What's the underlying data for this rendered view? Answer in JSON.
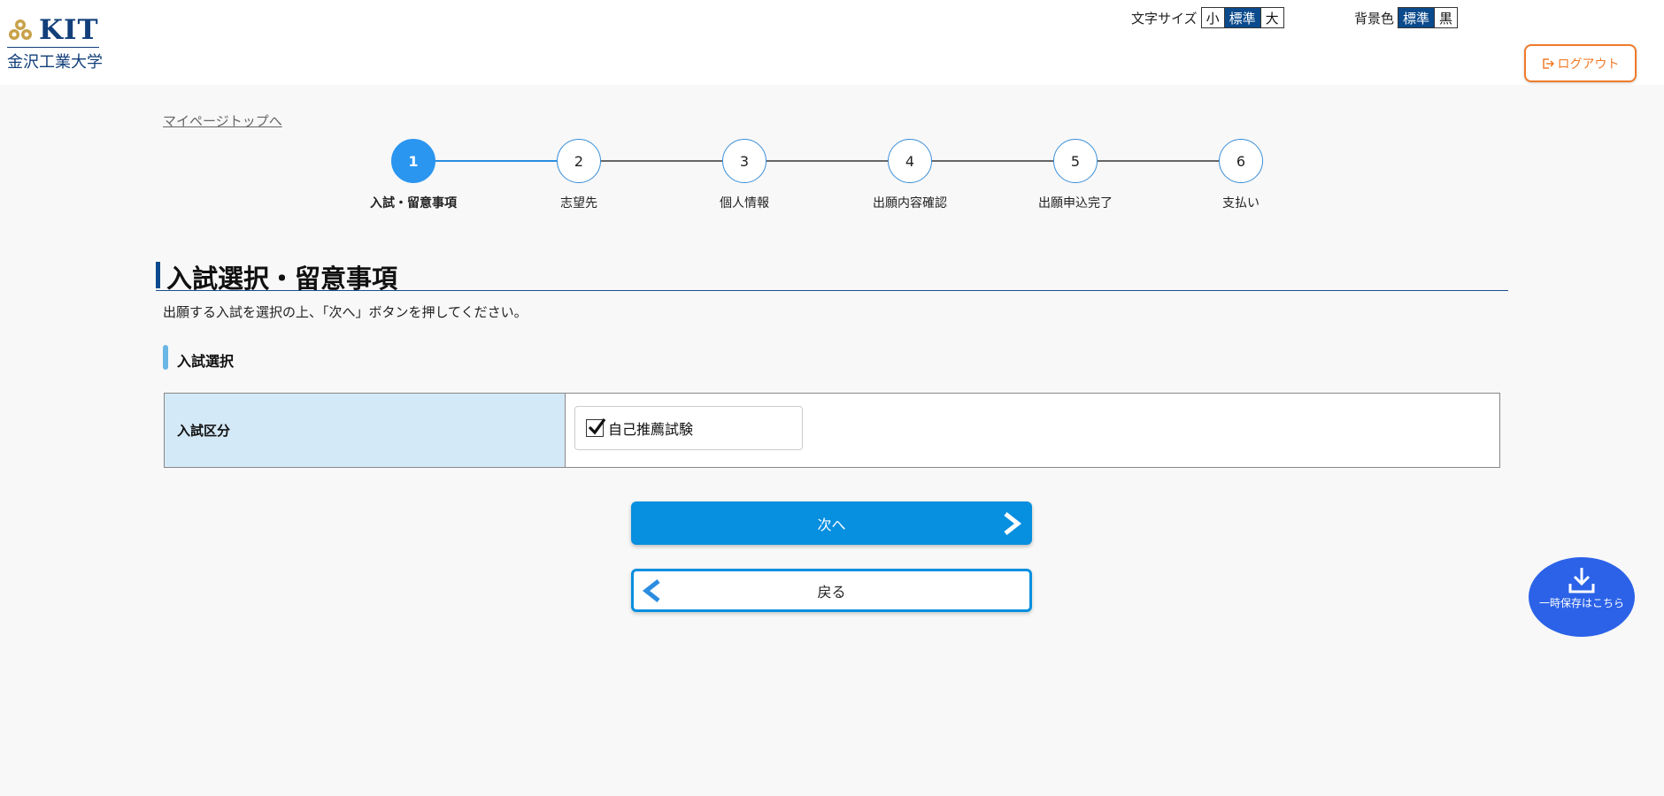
{
  "header": {
    "logo": {
      "text": "KIT",
      "name": "金沢工業大学"
    },
    "font_size": {
      "label": "文字サイズ",
      "options": [
        {
          "label": "小",
          "active": false
        },
        {
          "label": "標準",
          "active": true
        },
        {
          "label": "大",
          "active": false
        }
      ]
    },
    "bg_color": {
      "label": "背景色",
      "options": [
        {
          "label": "標準",
          "active": true
        },
        {
          "label": "黒",
          "active": false
        }
      ]
    },
    "logout_label": "ログアウト"
  },
  "breadcrumb": {
    "mypage_link": "マイページトップへ"
  },
  "stepper": {
    "current": 1,
    "steps": [
      {
        "number": "1",
        "label": "入試・留意事項"
      },
      {
        "number": "2",
        "label": "志望先"
      },
      {
        "number": "3",
        "label": "個人情報"
      },
      {
        "number": "4",
        "label": "出願内容確認"
      },
      {
        "number": "5",
        "label": "出願申込完了"
      },
      {
        "number": "6",
        "label": "支払い"
      }
    ]
  },
  "main": {
    "title": "入試選択・留意事項",
    "instruction": "出願する入試を選択の上、「次へ」ボタンを押してください。",
    "section_title": "入試選択",
    "table": {
      "label": "入試区分",
      "option": {
        "label": "自己推薦試験",
        "checked": true
      }
    },
    "next_label": "次へ",
    "back_label": "戻る"
  },
  "temp_save": {
    "label": "一時保存はこちら"
  },
  "colors": {
    "brand_navy": "#0b4a8c",
    "accent_blue": "#078fe0",
    "logout_orange": "#f07b2a",
    "temp_save_blue": "#2b62e8",
    "label_cell_bg": "#d4e9f7"
  }
}
